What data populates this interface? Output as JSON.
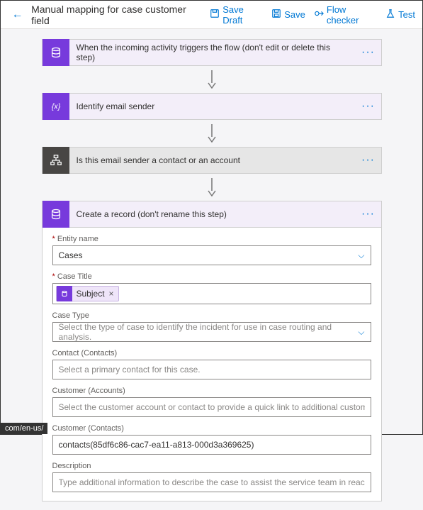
{
  "header": {
    "title": "Manual mapping for case customer field",
    "toolbar": {
      "save_draft": "Save Draft",
      "save": "Save",
      "flow_checker": "Flow checker",
      "test": "Test"
    }
  },
  "steps": {
    "trigger": {
      "label": "When the incoming activity triggers the flow (don't edit or delete this step)"
    },
    "identify": {
      "label": "Identify email sender"
    },
    "condition": {
      "label": "Is this email sender a contact or an account"
    },
    "create": {
      "label": "Create a record (don't rename this step)"
    }
  },
  "form": {
    "entity_name": {
      "label": "Entity name",
      "value": "Cases"
    },
    "case_title": {
      "label": "Case Title",
      "token": "Subject"
    },
    "case_type": {
      "label": "Case Type",
      "placeholder": "Select the type of case to identify the incident for use in case routing and analysis."
    },
    "contact_contacts": {
      "label": "Contact (Contacts)",
      "placeholder": "Select a primary contact for this case."
    },
    "customer_accounts": {
      "label": "Customer (Accounts)",
      "placeholder": "Select the customer account or contact to provide a quick link to additional customer details, such as ac"
    },
    "customer_contacts": {
      "label": "Customer (Contacts)",
      "value": "contacts(85df6c86-cac7-ea11-a813-000d3a369625)"
    },
    "description": {
      "label": "Description",
      "placeholder": "Type additional information to describe the case to assist the service team in reaching a resolution."
    }
  },
  "status_url": "com/en-us/"
}
